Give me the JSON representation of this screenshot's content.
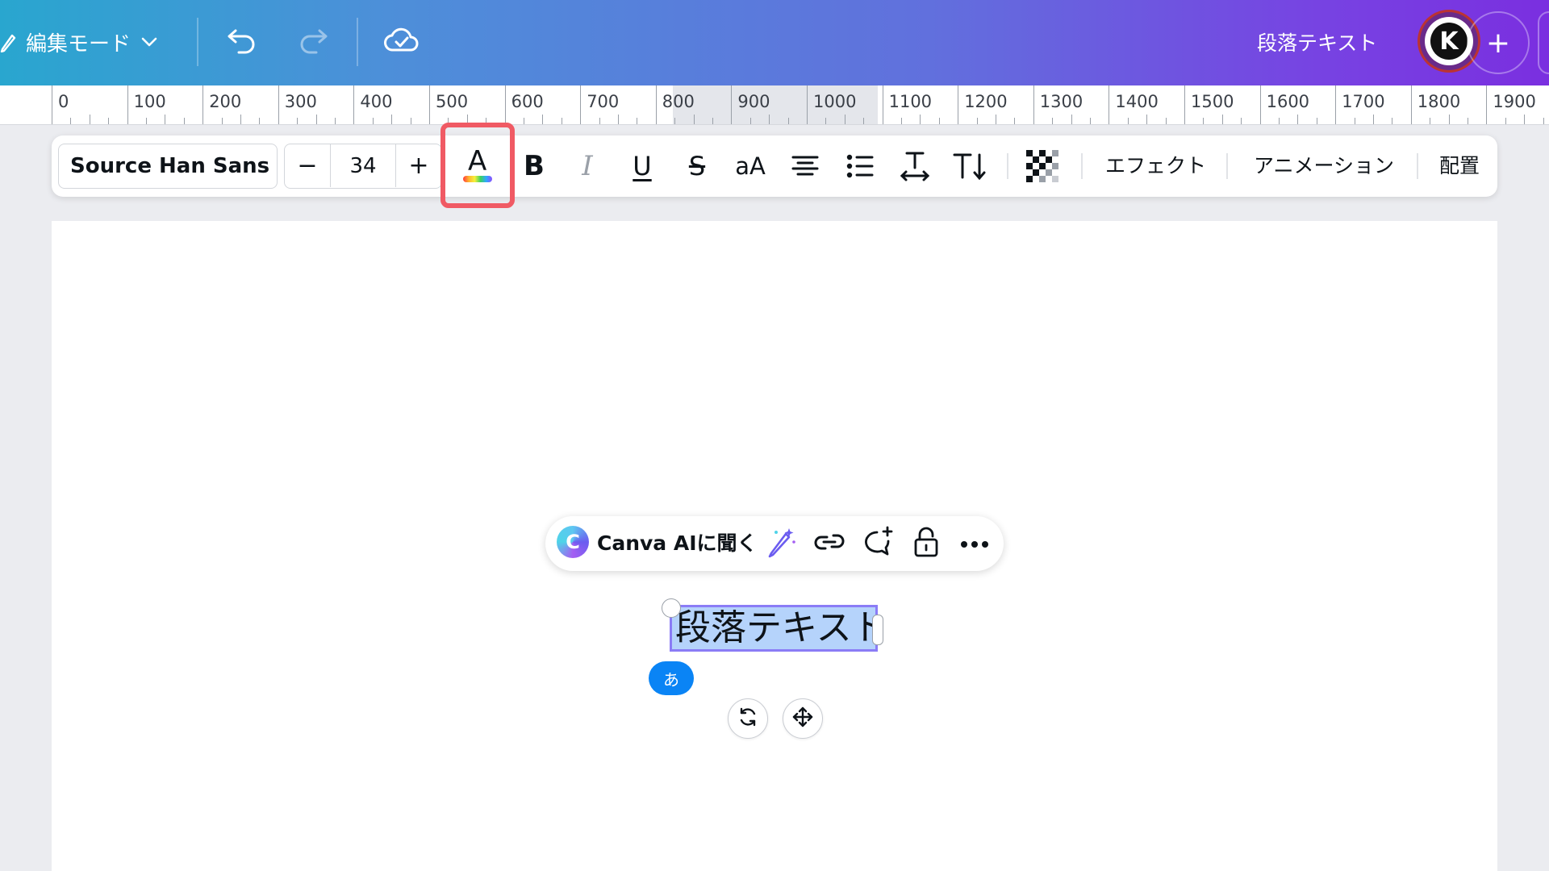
{
  "topbar": {
    "edit_mode_label": "編集モード",
    "title": "段落テキスト",
    "avatar_initial": "K",
    "add_symbol": "+",
    "gradient_colors": [
      "#29a6cf",
      "#6170dd",
      "#7a2fe0"
    ],
    "icons": [
      "pencil-icon",
      "chevron-down-icon",
      "undo-icon",
      "redo-icon",
      "cloud-saved-icon",
      "add-icon"
    ]
  },
  "ruler": {
    "labels": [
      "0",
      "100",
      "200",
      "300",
      "400",
      "500",
      "600",
      "700",
      "800",
      "900",
      "1000",
      "1100",
      "1200",
      "1300",
      "1400",
      "1500",
      "1600",
      "1700",
      "1800",
      "1900"
    ]
  },
  "text_toolbar": {
    "font_name": "Source Han Sans ...",
    "font_size": "34",
    "minus": "−",
    "plus": "+",
    "color_letter": "A",
    "bold_letter": "B",
    "italic_letter": "I",
    "underline_letter": "U",
    "strike_letter": "S",
    "case_label": "aA",
    "effects_label": "エフェクト",
    "animation_label": "アニメーション",
    "position_label": "配置",
    "highlight_color": "#f05a64"
  },
  "context_menu": {
    "ai_label": "Canva AIに聞く",
    "ai_logo_letter": "C",
    "icons": [
      "magic-edit-icon",
      "link-icon",
      "comment-add-icon",
      "lock-icon",
      "more-icon"
    ]
  },
  "canvas": {
    "selected_text": "段落テキスト",
    "ime_indicator": "あ",
    "selection_color": "#b5d3fb",
    "ime_color": "#0a84f5"
  }
}
